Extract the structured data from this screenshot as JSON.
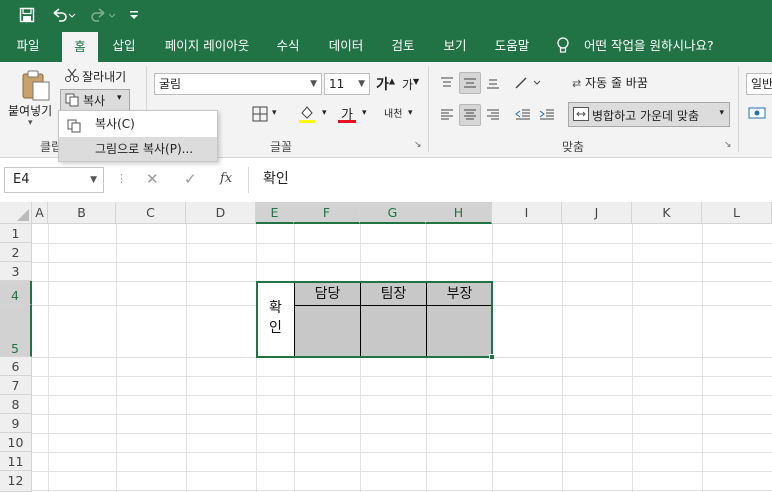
{
  "quick_access": {
    "save_icon": "save-icon",
    "undo_icon": "undo-icon",
    "redo_icon": "redo-icon",
    "customize_icon": "customize-icon"
  },
  "tabs": [
    {
      "label": "파일",
      "active": false
    },
    {
      "label": "홈",
      "active": true
    },
    {
      "label": "삽입",
      "active": false
    },
    {
      "label": "페이지 레이아웃",
      "active": false
    },
    {
      "label": "수식",
      "active": false
    },
    {
      "label": "데이터",
      "active": false
    },
    {
      "label": "검토",
      "active": false
    },
    {
      "label": "보기",
      "active": false
    },
    {
      "label": "도움말",
      "active": false
    }
  ],
  "tell_me": "어떤 작업을 원하시나요?",
  "ribbon": {
    "clipboard": {
      "paste_label": "붙여넣기",
      "cut_label": "잘라내기",
      "copy_label": "복사",
      "group_label": "클립"
    },
    "font": {
      "font_name": "굴림",
      "font_size": "11",
      "grow_glyph": "가",
      "shrink_glyph": "가",
      "font_color_glyph": "가",
      "phonetic_glyph": "내천",
      "group_label": "글꼴"
    },
    "alignment": {
      "wrap_text": "자동 줄 바꿈",
      "merge_center": "병합하고 가운데 맞춤",
      "group_label": "맞춤"
    },
    "number": {
      "format": "일반"
    },
    "colors": {
      "font_color_bar": "#e81123",
      "fill_color_bar": "#ffff00"
    }
  },
  "copy_menu": {
    "items": [
      {
        "label": "복사(C)"
      },
      {
        "label": "그림으로 복사(P)..."
      }
    ]
  },
  "formula_bar": {
    "name_box": "E4",
    "cancel_glyph": "✕",
    "enter_glyph": "✓",
    "fx_glyph": "fx",
    "value": "확인"
  },
  "columns": [
    "A",
    "B",
    "C",
    "D",
    "E",
    "F",
    "G",
    "H",
    "I",
    "J",
    "K",
    "L"
  ],
  "rows": [
    "1",
    "2",
    "3",
    "4",
    "5",
    "6",
    "7",
    "8",
    "9",
    "10",
    "11",
    "12"
  ],
  "approval_table": {
    "confirm_label": "확\n인",
    "headers": [
      "담당",
      "팀장",
      "부장"
    ]
  },
  "theme": {
    "accent": "#217346"
  }
}
